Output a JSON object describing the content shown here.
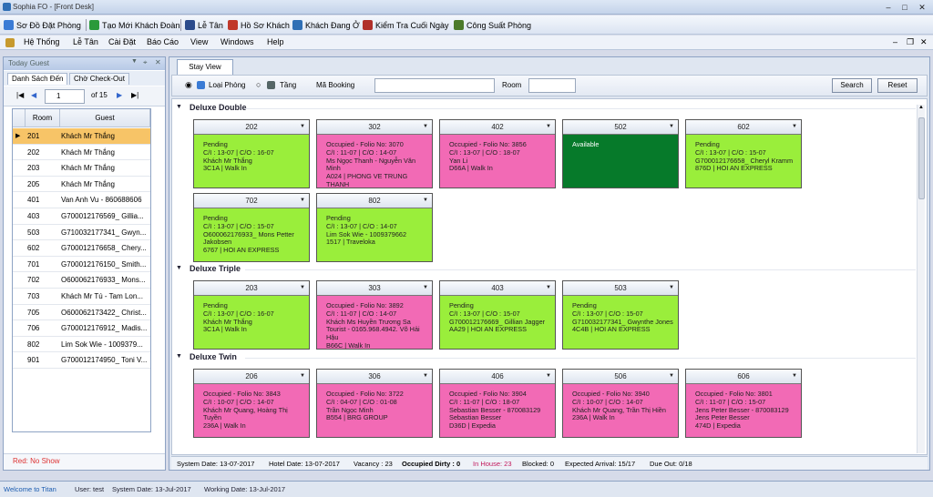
{
  "window": {
    "title": "Sophia FO - [Front Desk]"
  },
  "toolbar": {
    "items": [
      {
        "label": "Sơ Đồ Đặt Phòng",
        "icon": "calendar-grid-icon",
        "color": "#3a7bd5"
      },
      {
        "label": "Tạo Mới Khách Đoàn",
        "icon": "group-add-icon",
        "color": "#2a9a3a"
      },
      {
        "label": "Lễ Tân",
        "icon": "bell-desk-icon",
        "color": "#2b4b8c"
      },
      {
        "label": "Hồ Sơ Khách",
        "icon": "guest-file-icon",
        "color": "#c0392b"
      },
      {
        "label": "Khách Đang Ở",
        "icon": "house-icon",
        "color": "#2f6fb5"
      },
      {
        "label": "Kiểm Tra Cuối Ngày",
        "icon": "day-check-icon",
        "color": "#b0302a"
      },
      {
        "label": "Công Suất Phòng",
        "icon": "bar-chart-icon",
        "color": "#4c7a2a"
      }
    ]
  },
  "menu": {
    "items": [
      "Hệ Thống",
      "Lễ Tân",
      "Cài Đặt",
      "Báo Cáo",
      "View",
      "Windows",
      "Help"
    ]
  },
  "left_panel": {
    "title": "Today Guest",
    "tabs": [
      "Danh Sách Đến",
      "Chờ Check-Out"
    ],
    "pager": {
      "page": "1",
      "of_label": "of 15"
    },
    "columns": [
      "Room",
      "Guest"
    ],
    "rows": [
      {
        "room": "201",
        "guest": "Khách Mr Thắng",
        "selected": true
      },
      {
        "room": "202",
        "guest": "Khách Mr Thắng"
      },
      {
        "room": "203",
        "guest": "Khách Mr Thắng"
      },
      {
        "room": "205",
        "guest": "Khách Mr Thắng"
      },
      {
        "room": "401",
        "guest": "Van Anh Vu - 860688606"
      },
      {
        "room": "403",
        "guest": "G700012176569_ Gillia..."
      },
      {
        "room": "503",
        "guest": "G710032177341_ Gwyn..."
      },
      {
        "room": "602",
        "guest": "G700012176658_ Chery..."
      },
      {
        "room": "701",
        "guest": "G700012176150_ Smith..."
      },
      {
        "room": "702",
        "guest": "O600062176933_ Mons..."
      },
      {
        "room": "703",
        "guest": "Khách Mr Tú - Tam Lon..."
      },
      {
        "room": "705",
        "guest": "O600062173422_ Christ..."
      },
      {
        "room": "706",
        "guest": "G700012176912_ Madis..."
      },
      {
        "room": "802",
        "guest": "Lim Sok Wie - 1009379..."
      },
      {
        "room": "901",
        "guest": "G700012174950_ Toni V..."
      }
    ],
    "footer": "Red: No Show"
  },
  "main": {
    "tab": "Stay View",
    "filter": {
      "radio1": "Loại Phòng",
      "radio2": "Tầng",
      "booking_label": "Mã Booking",
      "room_label": "Room",
      "search": "Search",
      "reset": "Reset"
    },
    "sections": [
      {
        "title": "Deluxe Double",
        "rooms": [
          {
            "no": "202",
            "status": "pending",
            "lines": [
              "Pending",
              "C/I : 13-07 | C/O : 16-07",
              "Khách Mr Thắng",
              "3C1A | Walk In"
            ]
          },
          {
            "no": "302",
            "status": "occupied",
            "lines": [
              "Occupied - Folio No: 3070",
              "C/I : 11-07 | C/O : 14-07",
              "Ms Ngọc Thanh - Nguyễn Văn",
              "Minh",
              "A024 | PHONG VE TRUNG",
              "THANH"
            ]
          },
          {
            "no": "402",
            "status": "occupied",
            "lines": [
              "Occupied - Folio No: 3856",
              "C/I : 13-07 | C/O : 18-07",
              "Yan Li",
              "D66A | Walk In"
            ]
          },
          {
            "no": "502",
            "status": "available",
            "lines": [
              "Available"
            ]
          },
          {
            "no": "602",
            "status": "pending",
            "lines": [
              "Pending",
              "C/I : 13-07 | C/O : 15-07",
              "G700012176658_ Cheryl Kramm",
              "876D | HOI AN EXPRESS"
            ]
          },
          {
            "no": "702",
            "status": "pending",
            "lines": [
              "Pending",
              "C/I : 13-07 | C/O : 15-07",
              "O600062176933_ Mons Petter",
              "Jakobsen",
              "6767 | HOI AN EXPRESS"
            ]
          },
          {
            "no": "802",
            "status": "pending",
            "lines": [
              "Pending",
              "C/I : 13-07 | C/O : 14-07",
              "Lim Sok Wie - 1009379662",
              "1517 | Traveloka"
            ]
          }
        ]
      },
      {
        "title": "Deluxe Triple",
        "rooms": [
          {
            "no": "203",
            "status": "pending",
            "lines": [
              "Pending",
              "C/I : 13-07 | C/O : 16-07",
              "Khách Mr Thắng",
              "3C1A | Walk In"
            ]
          },
          {
            "no": "303",
            "status": "occupied",
            "lines": [
              "Occupied - Folio No: 3892",
              "C/I : 11-07 | C/O : 14-07",
              "Khách Ms Huyền Trương Sa",
              "Tourist - 0165.968.4942. Võ Hải",
              "Hậu",
              "B66C | Walk In"
            ]
          },
          {
            "no": "403",
            "status": "pending",
            "lines": [
              "Pending",
              "C/I : 13-07 | C/O : 15-07",
              "G700012176669_ Gillian Jagger",
              "AA29 | HOI AN EXPRESS"
            ]
          },
          {
            "no": "503",
            "status": "pending",
            "lines": [
              "Pending",
              "C/I : 13-07 | C/O : 15-07",
              "G710032177341_ Gwynthe Jones",
              "4C4B | HOI AN EXPRESS"
            ]
          }
        ]
      },
      {
        "title": "Deluxe Twin",
        "rooms": [
          {
            "no": "206",
            "status": "occupied",
            "lines": [
              "Occupied - Folio No: 3843",
              "C/I : 10-07 | C/O : 14-07",
              "Khách Mr Quang, Hoàng Thị",
              "Tuyền",
              "236A | Walk In"
            ]
          },
          {
            "no": "306",
            "status": "occupied",
            "lines": [
              "Occupied - Folio No: 3722",
              "C/I : 04-07 | C/O : 01-08",
              "Trần Ngọc Minh",
              "B554 | BRG GROUP"
            ]
          },
          {
            "no": "406",
            "status": "occupied",
            "lines": [
              "Occupied - Folio No: 3904",
              "C/I : 11-07 | C/O : 18-07",
              "Sebastian Besser - 870083129",
              "Sebastian Besser",
              "D36D | Expedia"
            ]
          },
          {
            "no": "506",
            "status": "occupied",
            "lines": [
              "Occupied - Folio No: 3940",
              "C/I : 10-07 | C/O : 14-07",
              "Khách Mr Quang, Trần Thị Hiền",
              "236A | Walk In"
            ]
          },
          {
            "no": "606",
            "status": "occupied",
            "lines": [
              "Occupied - Folio No: 3801",
              "C/I : 11-07 | C/O : 15-07",
              "Jens Peter Besser - 870083129",
              "Jens Peter Besser",
              "474D | Expedia"
            ]
          }
        ]
      }
    ],
    "status": {
      "system_date": "System Date: 13-07-2017",
      "hotel_date": "Hotel Date: 13-07-2017",
      "vacancy": "Vacancy : 23",
      "occupied_dirty": "Occupied Dirty : 0",
      "in_house": "In House: 23",
      "blocked": "Blocked: 0",
      "expected_arrival": "Expected Arrival: 15/17",
      "due_out": "Due Out: 0/18"
    }
  },
  "bottom": {
    "welcome": "Welcome to Titan",
    "user": "User: test",
    "system_date": "System Date: 13-Jul-2017",
    "working_date": "Working Date: 13-Jul-2017"
  },
  "colors": {
    "pending": "#9aee3b",
    "occupied": "#f26ab5",
    "available": "#067a2a",
    "in_house": "#c2185b"
  }
}
